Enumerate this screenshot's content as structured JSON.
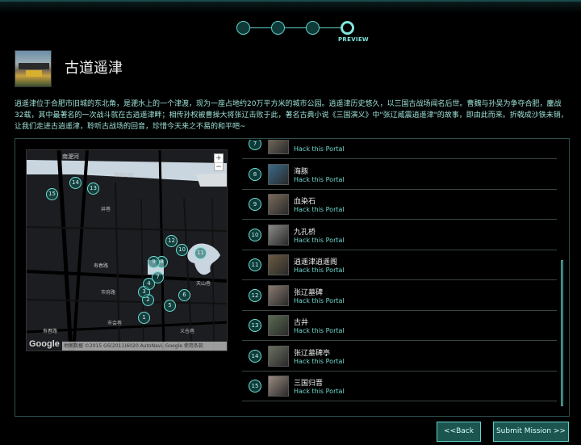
{
  "stepper": {
    "steps": 4,
    "active_index": 3,
    "active_label": "PREVIEW"
  },
  "header": {
    "title": "古道遥津"
  },
  "description": "逍遥津位于合肥市旧城的东北角，是淝水上的一个津渡，现为一座占地约20万平方米的城市公园。逍遥津历史悠久，以三国古战场闻名后世。曹魏与孙吴为争夺合肥，鏖战32载，其中最著名的一次战斗就在古逍遥津畔；相传孙权被曹操大将张辽击败于此，著名古典小说《三国演义》中\"张辽威震逍遥津\"的故事，即由此而来。折戟成沙铁未销，让我们走进古逍遥津，聆听古战场的回音，珍惜今天来之不易的和平吧~",
  "map": {
    "streets": [
      "南淝河",
      "环城公园",
      "井巷",
      "宿州路",
      "阜南路",
      "淮河路",
      "寿春路",
      "市府路",
      "阜南路",
      "淮河路",
      "长江中路",
      "天山巷",
      "义仓巷",
      "市会巷"
    ],
    "pins": [
      "1",
      "2",
      "3",
      "4",
      "5",
      "6",
      "7",
      "8",
      "9",
      "10",
      "11",
      "12",
      "13",
      "14",
      "15"
    ],
    "zoom_in": "+",
    "zoom_out": "−",
    "logo": "Google",
    "attribution": "地图数据 ©2015 GS(2011)6020 AutoNavi, Google  使用条款"
  },
  "portals": [
    {
      "num": "7",
      "name": "",
      "action": "Hack this Portal",
      "color": "#7a7060"
    },
    {
      "num": "8",
      "name": "海豚",
      "action": "Hack this Portal",
      "color": "#3a6a8a"
    },
    {
      "num": "9",
      "name": "血染石",
      "action": "Hack this Portal",
      "color": "#7a6a5a"
    },
    {
      "num": "10",
      "name": "九孔桥",
      "action": "Hack this Portal",
      "color": "#8a8a88"
    },
    {
      "num": "11",
      "name": "逍遥津逍遥阁",
      "action": "Hack this Portal",
      "color": "#6a5a40"
    },
    {
      "num": "12",
      "name": "张辽墓碑",
      "action": "Hack this Portal",
      "color": "#8a7a70"
    },
    {
      "num": "13",
      "name": "古井",
      "action": "Hack this Portal",
      "color": "#5a6a50"
    },
    {
      "num": "14",
      "name": "张辽墓碑亭",
      "action": "Hack this Portal",
      "color": "#6a7060"
    },
    {
      "num": "15",
      "name": "三国归晋",
      "action": "Hack this Portal",
      "color": "#9a8a80"
    }
  ],
  "buttons": {
    "back": "<<Back",
    "submit": "Submit Mission >>"
  },
  "colors": {
    "accent": "#5fd3c8",
    "button_bg": "#1c5450",
    "description": "#9de0d6"
  }
}
